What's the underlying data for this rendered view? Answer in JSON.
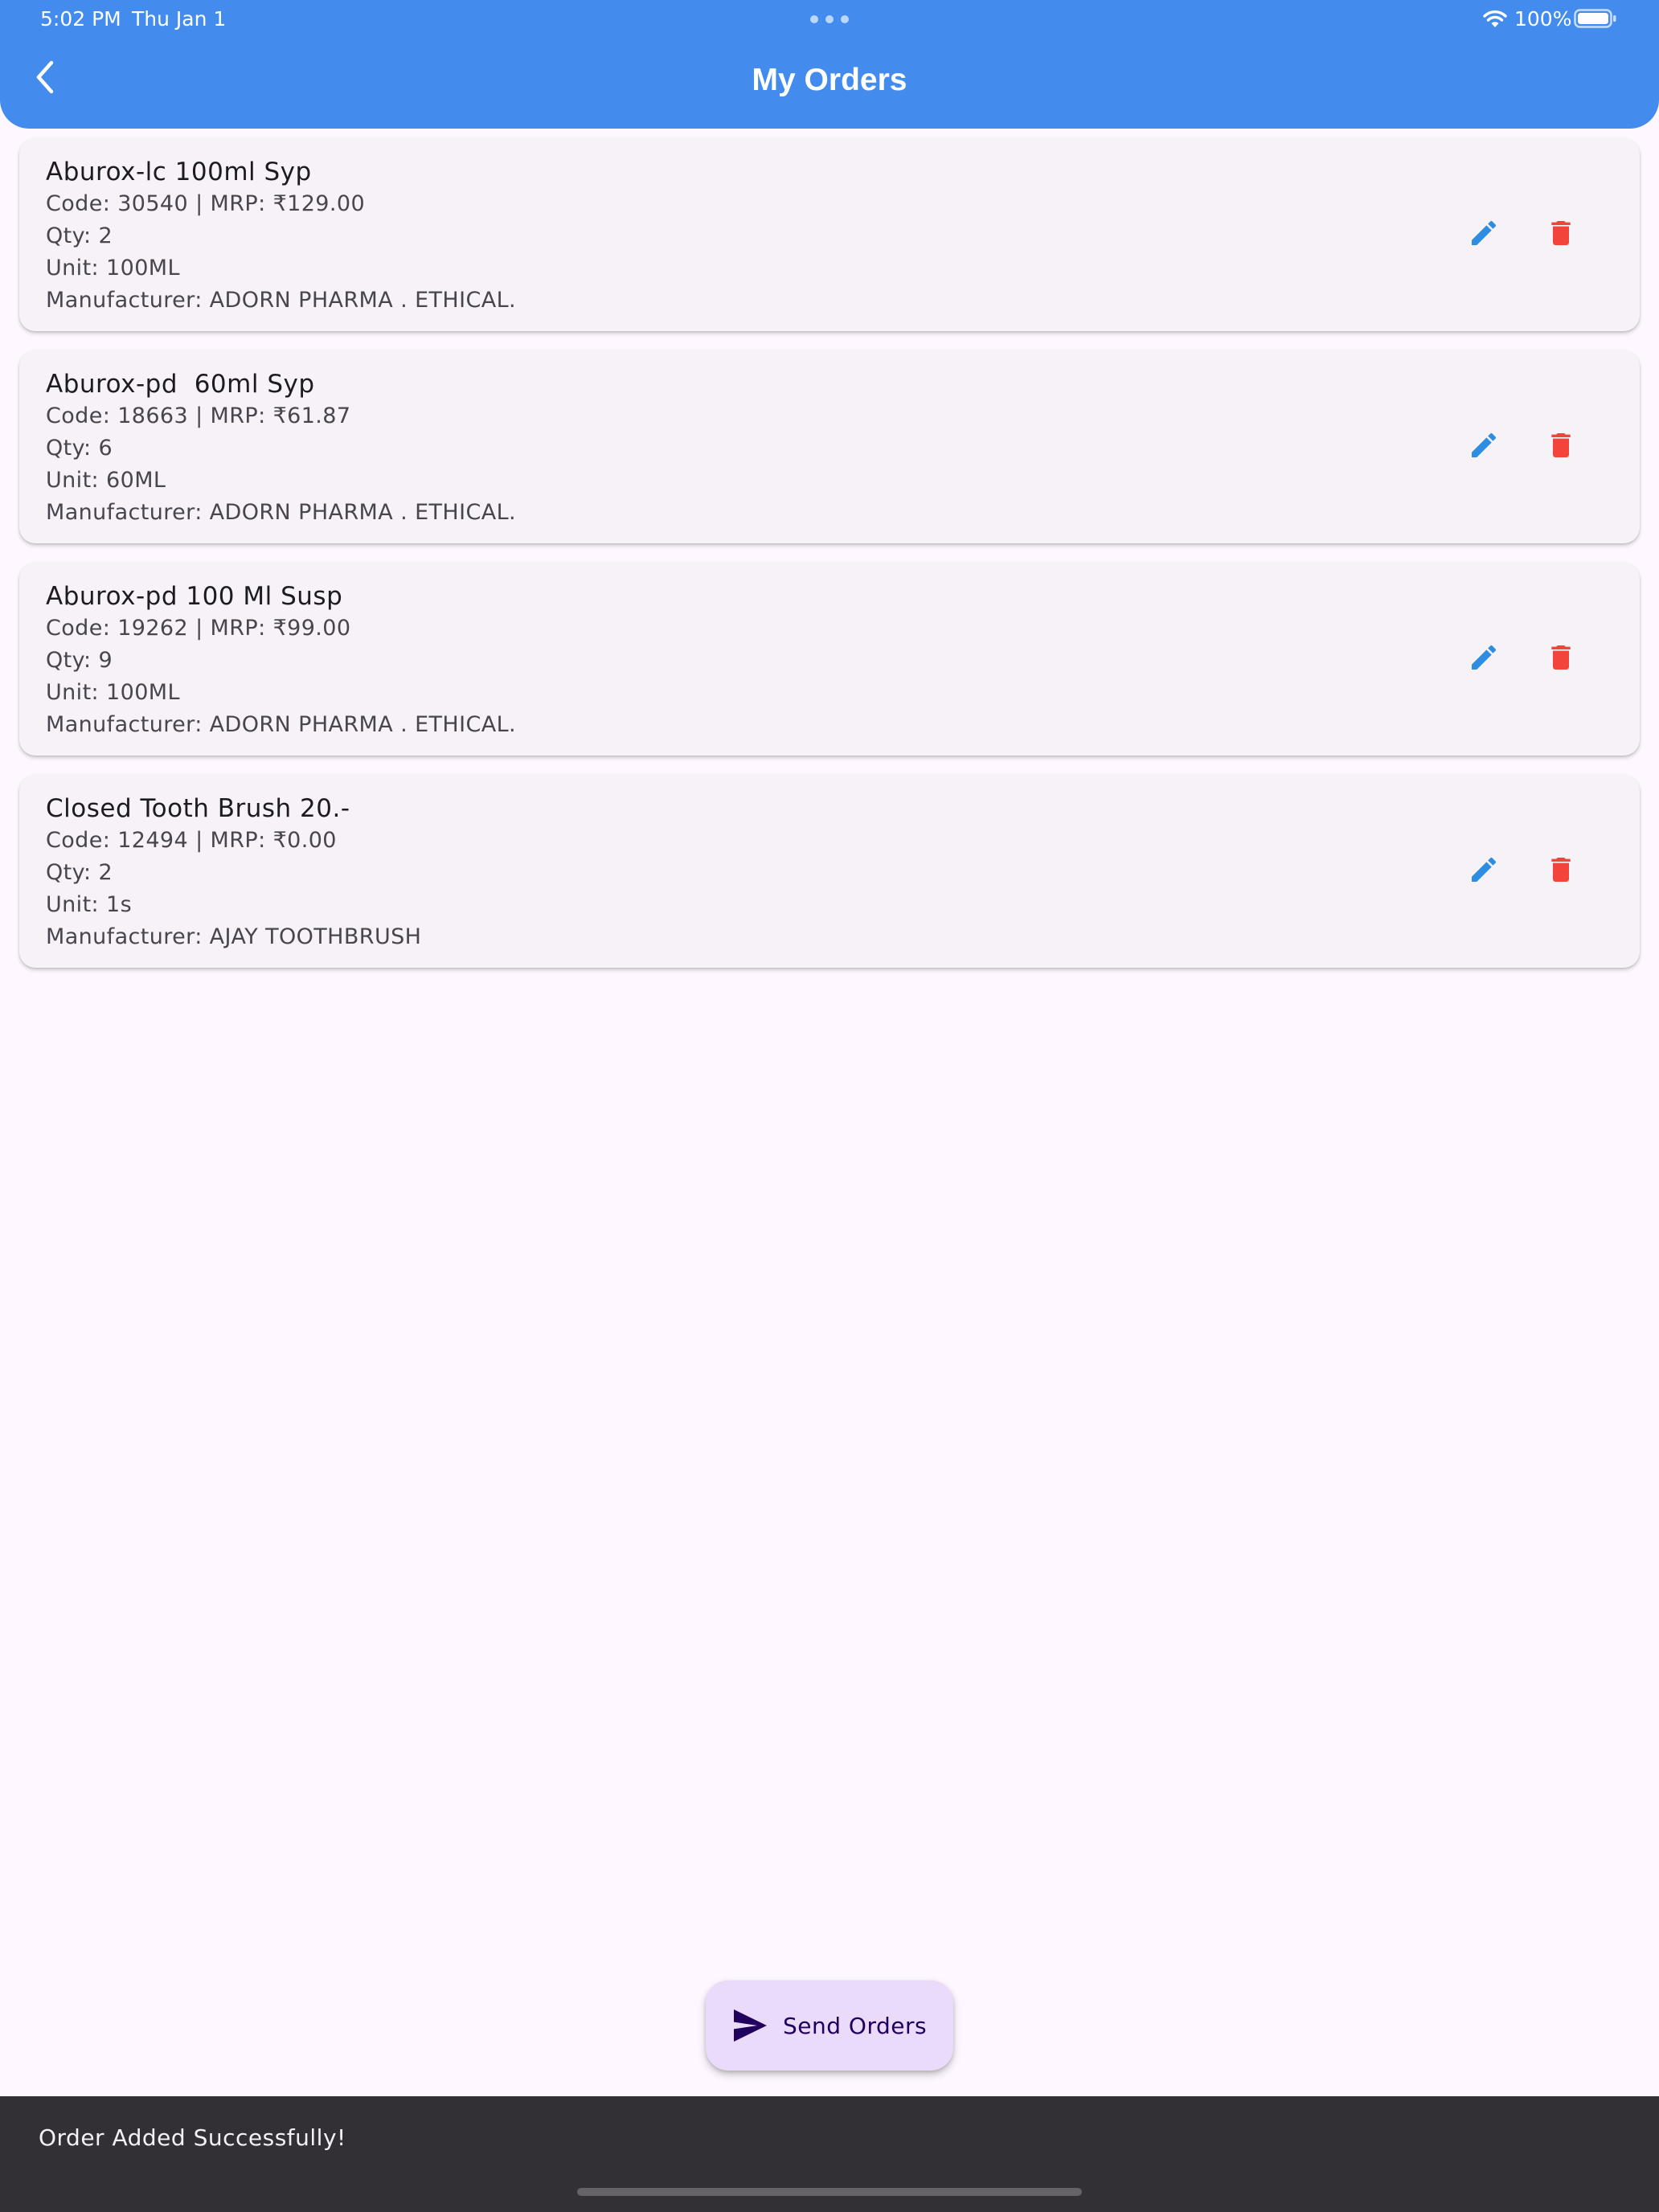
{
  "status_bar": {
    "time": "5:02 PM",
    "date": "Thu Jan 1",
    "battery": "100%"
  },
  "header": {
    "title": "My Orders",
    "back_icon": "chevron-left-icon"
  },
  "colors": {
    "app_bar": "#438cee",
    "edit_icon": "#2c8de3",
    "delete_icon": "#f2443a",
    "card_bg": "#f7f2f8",
    "fab_bg": "#eadbfb",
    "snackbar_bg": "#322f35"
  },
  "orders": [
    {
      "name": "Aburox-lc 100ml Syp",
      "code_mrp": "Code: 30540 | MRP: ₹129.00",
      "qty": "Qty: 2",
      "unit": "Unit: 100ML",
      "manufacturer": "Manufacturer: ADORN PHARMA . ETHICAL."
    },
    {
      "name": "Aburox-pd  60ml Syp",
      "code_mrp": "Code: 18663 | MRP: ₹61.87",
      "qty": "Qty: 6",
      "unit": "Unit: 60ML",
      "manufacturer": "Manufacturer: ADORN PHARMA . ETHICAL."
    },
    {
      "name": "Aburox-pd 100 Ml Susp",
      "code_mrp": "Code: 19262 | MRP: ₹99.00",
      "qty": "Qty: 9",
      "unit": "Unit: 100ML",
      "manufacturer": "Manufacturer: ADORN PHARMA . ETHICAL."
    },
    {
      "name": "Closed Tooth Brush 20.-",
      "code_mrp": "Code: 12494 | MRP: ₹0.00",
      "qty": "Qty: 2",
      "unit": "Unit: 1s",
      "manufacturer": "Manufacturer: AJAY TOOTHBRUSH"
    }
  ],
  "row_icons": {
    "edit": "pencil-icon",
    "delete": "trash-icon"
  },
  "fab": {
    "label": "Send Orders",
    "icon": "send-icon"
  },
  "snackbar": {
    "message": "Order Added Successfully!"
  }
}
